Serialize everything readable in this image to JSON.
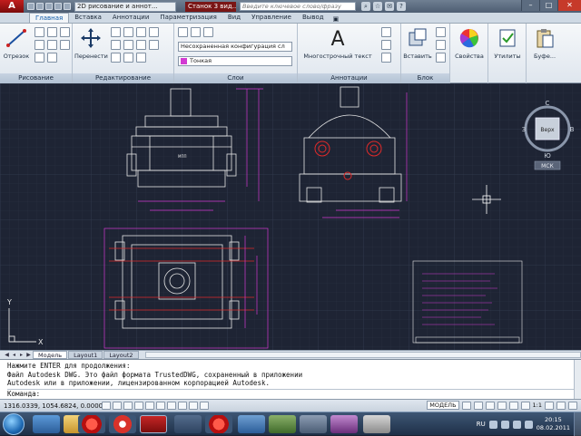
{
  "titlebar": {
    "app_logo": "A",
    "workspace": "2D рисование и аннот...",
    "document_title": "Станок 3 вид...",
    "search_placeholder": "Введите ключевое слово/фразу",
    "window_buttons": [
      "–",
      "□",
      "✕"
    ]
  },
  "ribbon_tabs": {
    "tabs": [
      "Главная",
      "Вставка",
      "Аннотации",
      "Параметризация",
      "Вид",
      "Управление",
      "Вывод"
    ],
    "active": "Главная"
  },
  "ribbon": {
    "draw": {
      "label": "Рисование",
      "line": "Отрезок"
    },
    "modify": {
      "label": "Редактирование",
      "move": "Перенести"
    },
    "layers": {
      "label": "Слои",
      "config": "Несохраненная конфигурация сл",
      "lineweight": "Тонкая"
    },
    "annotations": {
      "label": "Аннотации",
      "mtext": "Многострочный текст"
    },
    "block": {
      "label": "Блок",
      "insert": "Вставить"
    },
    "properties": {
      "label": "Свойства"
    },
    "utilities": {
      "label": "Утилиты"
    },
    "clipboard": {
      "label": "Буфе..."
    }
  },
  "viewcube": {
    "top": "С",
    "bottom": "Ю",
    "left": "З",
    "right": "В",
    "face": "Верх",
    "wcs": "МСК"
  },
  "drawing": {
    "ucs_x": "X",
    "ucs_y": "Y"
  },
  "layout_tabs": {
    "tabs": [
      "Модель",
      "Layout1",
      "Layout2"
    ],
    "active": "Модель"
  },
  "command_line": {
    "lines": [
      "Нажмите ENTER для продолжения:",
      "Файл Autodesk DWG. Это файл формата TrustedDWG, сохраненный в приложении",
      "Autodesk или в приложении, лицензированном корпорацией Autodesk."
    ],
    "prompt": "Команда:"
  },
  "statusbar": {
    "coords": "1316.0339, 1054.6824, 0.0000",
    "model": "МОДЕЛЬ",
    "scale": "1:1"
  },
  "taskbar": {
    "language": "RU",
    "time": "20:15",
    "date": "08.02.2011"
  },
  "colors": {
    "drawing_bg": "#1e2434",
    "geometry_white": "#e6e6e6",
    "geometry_magenta": "#d23ad2",
    "geometry_red": "#e02a2a"
  }
}
